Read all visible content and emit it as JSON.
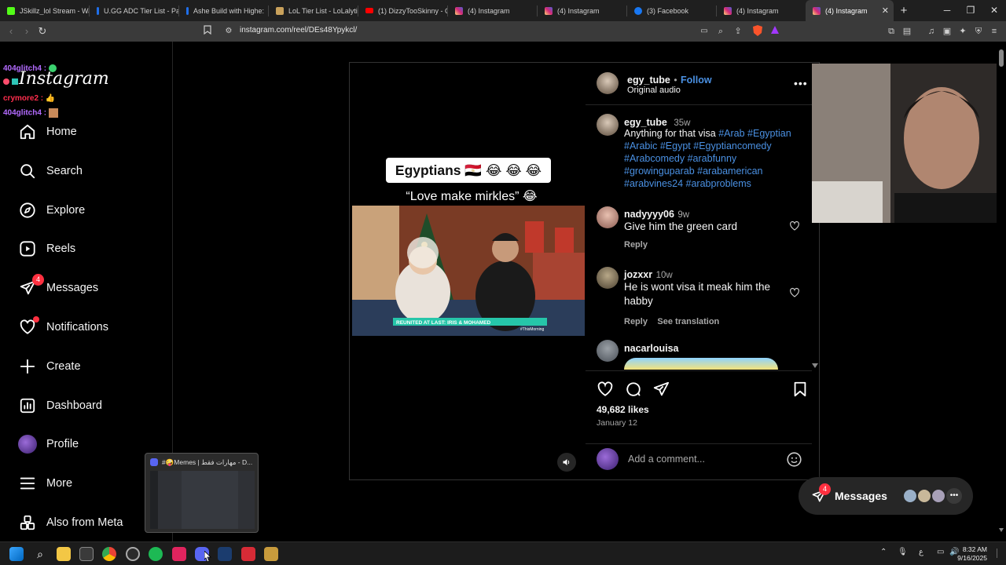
{
  "browser": {
    "tabs": [
      {
        "title": "JSkillz_lol Stream - Wat",
        "color": "#53fc18"
      },
      {
        "title": "U.GG ADC Tier List - Pa",
        "color": "#1f6feb"
      },
      {
        "title": "Ashe Build with Highe:",
        "color": "#1f6feb"
      },
      {
        "title": "LoL Tier List - LoLalytic",
        "color": "#c9a15b"
      },
      {
        "title": "(1) DizzyTooSkinny - C",
        "color": "#ff0000"
      },
      {
        "title": "(4) Instagram",
        "color": "#d6249f"
      },
      {
        "title": "(4) Instagram",
        "color": "#d6249f"
      },
      {
        "title": "(3) Facebook",
        "color": "#1877f2"
      },
      {
        "title": "(4) Instagram",
        "color": "#d6249f"
      },
      {
        "title": "(4) Instagram",
        "color": "#d6249f"
      }
    ],
    "url": "instagram.com/reel/DEs48Ypykcl/"
  },
  "chat": [
    {
      "user": "404glitch4 :",
      "color": "#b36bff"
    },
    {
      "user": "",
      "color": "#ff4d6d"
    },
    {
      "user": "crymore2 :",
      "color": "#ff2e4d"
    },
    {
      "user": "404glitch4 :",
      "color": "#b36bff"
    }
  ],
  "sidebar": {
    "logo": "Instagram",
    "items": [
      {
        "label": "Home",
        "icon": "home-icon"
      },
      {
        "label": "Search",
        "icon": "search-icon"
      },
      {
        "label": "Explore",
        "icon": "compass-icon"
      },
      {
        "label": "Reels",
        "icon": "reels-icon"
      },
      {
        "label": "Messages",
        "icon": "messenger-icon",
        "badge": "4"
      },
      {
        "label": "Notifications",
        "icon": "heart-icon"
      },
      {
        "label": "Create",
        "icon": "plus-icon"
      },
      {
        "label": "Dashboard",
        "icon": "dashboard-icon"
      },
      {
        "label": "Profile",
        "icon": "profile-avatar"
      },
      {
        "label": "More",
        "icon": "menu-icon"
      },
      {
        "label": "Also from Meta",
        "icon": "meta-apps-icon"
      }
    ]
  },
  "reel": {
    "caption_title": "Egyptians 🇪🇬 😂 😂 😂",
    "caption_sub": "“Love make mirkles” 😂",
    "banner": "REUNITED AT LAST: IRIS & MOHAMED",
    "watermark": "#ThisMorning"
  },
  "post": {
    "author": "egy_tube",
    "follow": "Follow",
    "dot": "•",
    "audio": "Original audio",
    "caption": {
      "user": "egy_tube",
      "time": "35w",
      "text": "Anything for that visa",
      "hashtags": "#Arab #Egyptian #Arabic #Egypt #Egyptiancomedy #Arabcomedy #arabfunny #growinguparab #arabamerican #arabvines24 #arabproblems"
    },
    "comments": [
      {
        "user": "nadyyyy06",
        "time": "9w",
        "text": "Give him the green card",
        "reply": "Reply"
      },
      {
        "user": "jozxxr",
        "time": "10w",
        "text": "He is wont visa it meak him the habby",
        "reply": "Reply",
        "translate": "See translation"
      },
      {
        "user": "nacarlouisa",
        "time": "",
        "text": "",
        "reply": ""
      }
    ],
    "likes": "49,682 likes",
    "date": "January 12",
    "comment_placeholder": "Add a comment..."
  },
  "messages_pill": {
    "label": "Messages",
    "badge": "4"
  },
  "thumbnail": {
    "title": "#🤪Memes | مهارات فقط - D..."
  },
  "taskbar": {
    "time": "8:32 AM",
    "date": "9/16/2025",
    "lang": "ع"
  }
}
